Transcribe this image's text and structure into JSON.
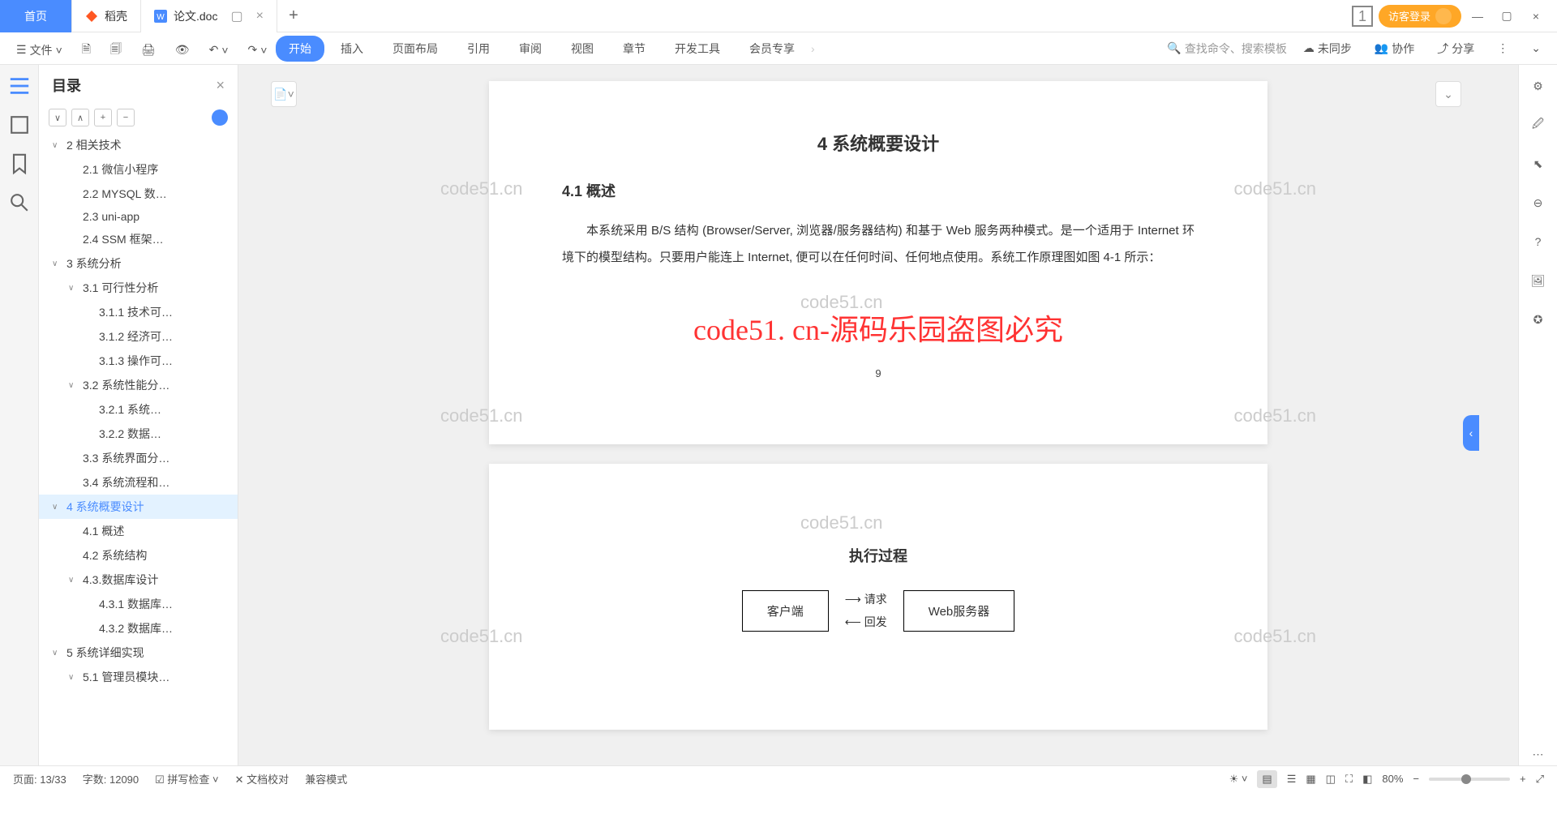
{
  "tabs": {
    "home": "首页",
    "docker": "稻壳",
    "doc": "论文.doc"
  },
  "login": "访客登录",
  "toolbar": {
    "file": "文件"
  },
  "ribbon": {
    "start": "开始",
    "insert": "插入",
    "layout": "页面布局",
    "ref": "引用",
    "review": "审阅",
    "view": "视图",
    "chapter": "章节",
    "dev": "开发工具",
    "vip": "会员专享"
  },
  "search_placeholder": "查找命令、搜索模板",
  "sync": "未同步",
  "collab": "协作",
  "share": "分享",
  "outline": {
    "title": "目录"
  },
  "tree": [
    {
      "t": "∨",
      "l": 1,
      "label": "2 相关技术"
    },
    {
      "t": "",
      "l": 2,
      "label": "2.1 微信小程序"
    },
    {
      "t": "",
      "l": 2,
      "label": "2.2 MYSQL 数…"
    },
    {
      "t": "",
      "l": 2,
      "label": "2.3 uni-app"
    },
    {
      "t": "",
      "l": 2,
      "label": "2.4 SSM 框架…"
    },
    {
      "t": "∨",
      "l": 1,
      "label": "3 系统分析"
    },
    {
      "t": "∨",
      "l": 2,
      "label": "3.1 可行性分析"
    },
    {
      "t": "",
      "l": 3,
      "label": "3.1.1 技术可…"
    },
    {
      "t": "",
      "l": 3,
      "label": "3.1.2 经济可…"
    },
    {
      "t": "",
      "l": 3,
      "label": "3.1.3 操作可…"
    },
    {
      "t": "∨",
      "l": 2,
      "label": "3.2 系统性能分…"
    },
    {
      "t": "",
      "l": 3,
      "label": "3.2.1  系统…"
    },
    {
      "t": "",
      "l": 3,
      "label": "3.2.2  数据…"
    },
    {
      "t": "",
      "l": 2,
      "label": "3.3 系统界面分…"
    },
    {
      "t": "",
      "l": 2,
      "label": "3.4 系统流程和…"
    },
    {
      "t": "∨",
      "l": 1,
      "label": "4 系统概要设计",
      "sel": true
    },
    {
      "t": "",
      "l": 2,
      "label": "4.1 概述"
    },
    {
      "t": "",
      "l": 2,
      "label": "4.2 系统结构"
    },
    {
      "t": "∨",
      "l": 2,
      "label": "4.3.数据库设计"
    },
    {
      "t": "",
      "l": 3,
      "label": "4.3.1 数据库…"
    },
    {
      "t": "",
      "l": 3,
      "label": "4.3.2 数据库…"
    },
    {
      "t": "∨",
      "l": 1,
      "label": "5 系统详细实现"
    },
    {
      "t": "∨",
      "l": 2,
      "label": "5.1 管理员模块…"
    }
  ],
  "doc": {
    "h1": "4 系统概要设计",
    "h2": "4.1 概述",
    "p1": "本系统采用 B/S 结构 (Browser/Server, 浏览器/服务器结构) 和基于 Web 服务两种模式。是一个适用于 Internet 环境下的模型结构。只要用户能连上 Internet, 便可以在任何时间、任何地点使用。系统工作原理图如图 4-1 所示：",
    "pnum": "9",
    "diagram_title": "执行过程",
    "box1": "客户端",
    "box2": "Web服务器",
    "arr1": "请求",
    "arr2": "回发"
  },
  "watermark": "code51.cn",
  "overlay": "code51. cn-源码乐园盗图必究",
  "status": {
    "page": "页面: 13/33",
    "words": "字数: 12090",
    "spell": "拼写检查",
    "proof": "文档校对",
    "compat": "兼容模式",
    "zoom": "80%"
  }
}
